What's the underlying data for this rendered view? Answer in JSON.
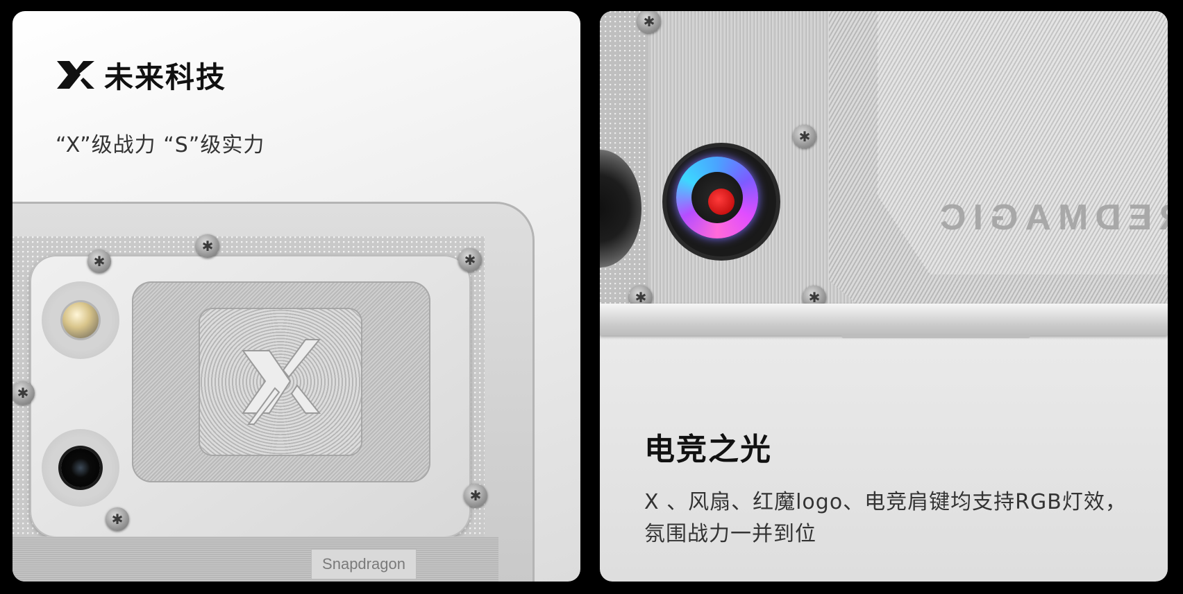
{
  "left_card": {
    "title": "未来科技",
    "subtitle": "“X”级战力 “S”级实力",
    "chip_badge": "Snapdragon",
    "logo_icon": "x-logo-icon"
  },
  "right_card": {
    "title": "电竞之光",
    "description_line1": "X 、风扇、红魔logo、电竞肩键均支持RGB灯效，",
    "description_line2": "氛围战力一并到位",
    "mirrored_brand": "REDMAGIC"
  },
  "colors": {
    "background": "#000000",
    "card": "#f2f2f2",
    "text_dark": "#111111",
    "fan_led": [
      "#4aa3ff",
      "#e04dff"
    ],
    "fan_center": "#d40000"
  }
}
